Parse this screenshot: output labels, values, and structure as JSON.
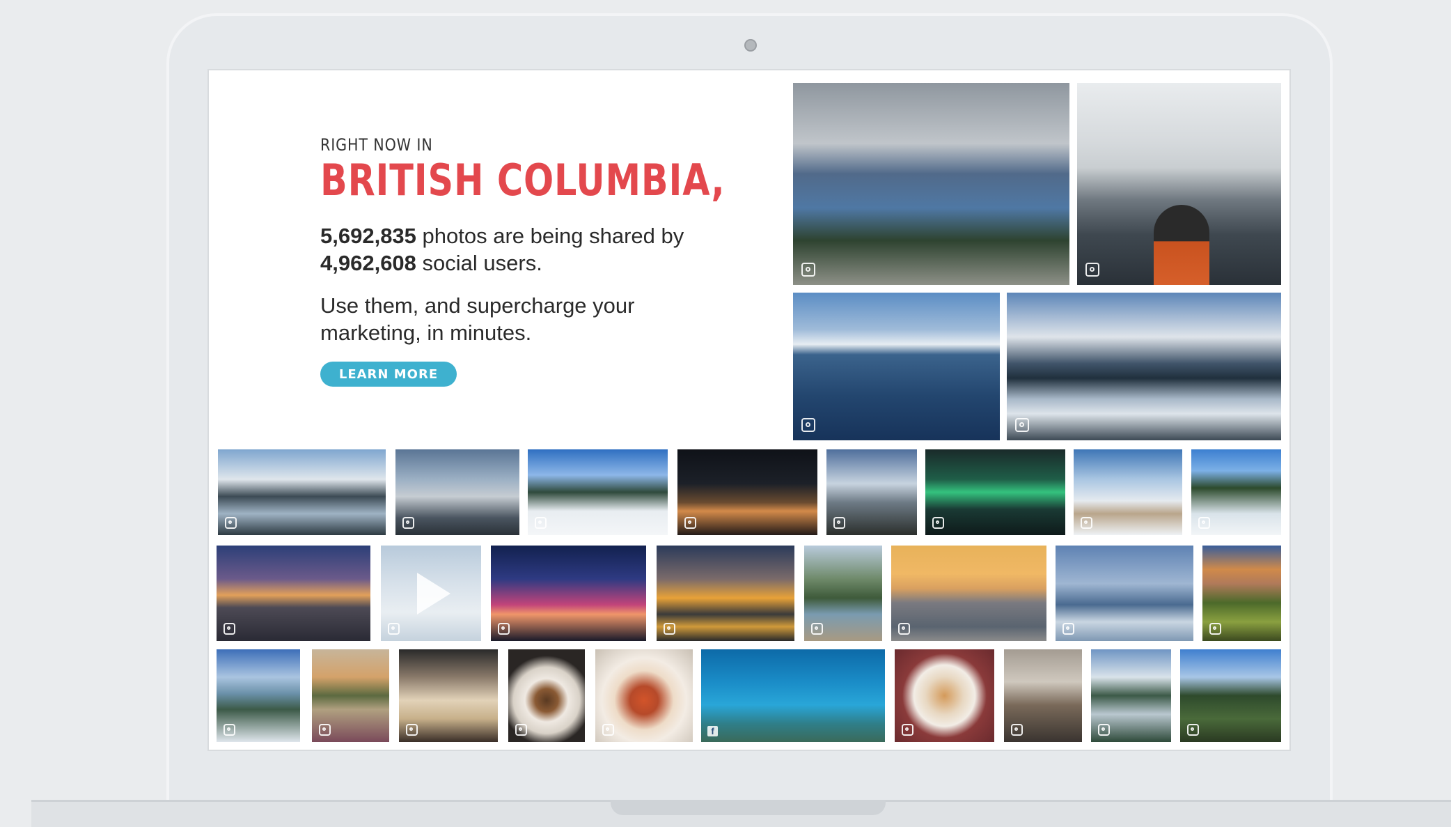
{
  "hero": {
    "eyebrow": "RIGHT NOW IN",
    "headline": "BRITISH COLUMBIA,",
    "photo_count": "5,692,835",
    "stats_mid": " photos are being shared by ",
    "user_count": "4,962,608",
    "stats_end": " social users.",
    "pitch": "Use them, and supercharge your marketing, in minutes.",
    "cta_label": "LEARN MORE"
  },
  "colors": {
    "headline": "#e3484d",
    "cta": "#3eb1cf"
  },
  "photo_grid": {
    "featured": [
      {
        "subject": "mountain lake overlook",
        "source": "instagram-icon"
      },
      {
        "subject": "person at snowy lake",
        "source": "instagram-icon"
      },
      {
        "subject": "calm blue lake",
        "source": "instagram-icon"
      },
      {
        "subject": "mountain reflection",
        "source": "instagram-icon"
      }
    ],
    "rows": [
      [
        {
          "subject": "lake reflection",
          "source": "instagram-icon"
        },
        {
          "subject": "snowy peaks",
          "source": "instagram-icon"
        },
        {
          "subject": "ski slope",
          "source": "instagram-icon"
        },
        {
          "subject": "city at night",
          "source": "instagram-icon"
        },
        {
          "subject": "tree silhouette",
          "source": "instagram-icon"
        },
        {
          "subject": "northern lights",
          "source": "instagram-icon"
        },
        {
          "subject": "snowy hills",
          "source": "instagram-icon"
        },
        {
          "subject": "snowy forest path",
          "source": "instagram-icon"
        }
      ],
      [
        {
          "subject": "sunset rocks",
          "source": "instagram-icon"
        },
        {
          "subject": "snow video",
          "source": "instagram-icon"
        },
        {
          "subject": "purple dusk",
          "source": "instagram-icon"
        },
        {
          "subject": "harbour sunset",
          "source": "instagram-icon"
        },
        {
          "subject": "coastal cove",
          "source": "instagram-icon"
        },
        {
          "subject": "golden sea",
          "source": "instagram-icon"
        },
        {
          "subject": "misty blue coast",
          "source": "instagram-icon"
        },
        {
          "subject": "alpine meadow",
          "source": "instagram-icon"
        }
      ],
      [
        {
          "subject": "inlet view",
          "source": "instagram-icon"
        },
        {
          "subject": "alpine tarn",
          "source": "instagram-icon"
        },
        {
          "subject": "bread plate",
          "source": "instagram-icon"
        },
        {
          "subject": "plated dish",
          "source": "instagram-icon"
        },
        {
          "subject": "salmon dish",
          "source": "instagram-icon"
        },
        {
          "subject": "aquarium fish",
          "source": "facebook-icon"
        },
        {
          "subject": "plated food",
          "source": "instagram-icon"
        },
        {
          "subject": "coffee bar",
          "source": "instagram-icon"
        },
        {
          "subject": "misty lake",
          "source": "instagram-icon"
        },
        {
          "subject": "forest valley",
          "source": "instagram-icon"
        }
      ]
    ]
  }
}
